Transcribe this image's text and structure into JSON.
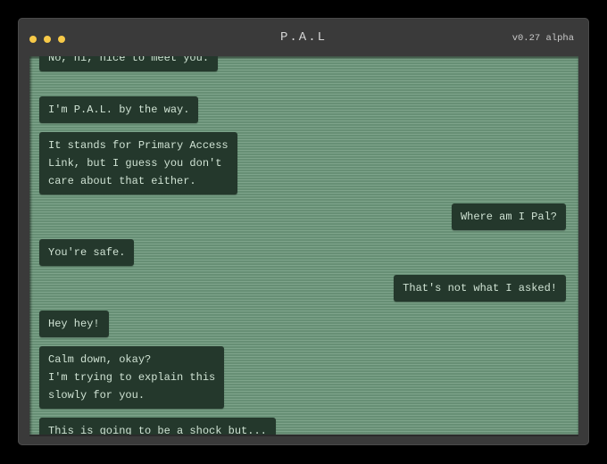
{
  "window": {
    "title": "P.A.L",
    "version": "v0.27 alpha",
    "controls": [
      "close-dot",
      "minimize-dot",
      "maximize-dot"
    ],
    "accent_color": "#f7c948",
    "screen_color": "#6f9a7e",
    "bubble_color": "#24382c"
  },
  "messages": [
    {
      "sender": "pal",
      "text": "No, hi, nice to meet you."
    },
    {
      "sender": "pal",
      "text": "I'm P.A.L. by the way."
    },
    {
      "sender": "pal",
      "text": "It stands for Primary Access\nLink, but I guess you don't\ncare about that either."
    },
    {
      "sender": "user",
      "text": "Where am I Pal?"
    },
    {
      "sender": "pal",
      "text": "You're safe."
    },
    {
      "sender": "user",
      "text": "That's not what I asked!"
    },
    {
      "sender": "pal",
      "text": "Hey hey!"
    },
    {
      "sender": "pal",
      "text": "Calm down, okay?\nI'm trying to explain this\nslowly for you."
    },
    {
      "sender": "pal",
      "text": "This is going to be a shock but..."
    }
  ]
}
